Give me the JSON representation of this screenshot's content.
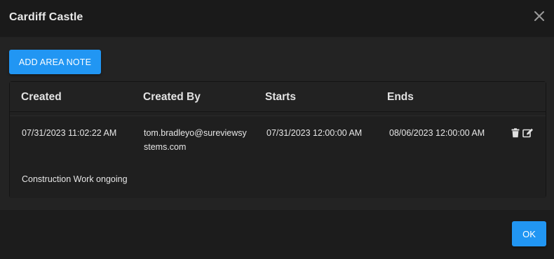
{
  "dialog": {
    "title": "Cardiff Castle",
    "close_icon": "close-icon"
  },
  "toolbar": {
    "add_label": "ADD AREA NOTE"
  },
  "table": {
    "columns": [
      "Created",
      "Created By",
      "Starts",
      "Ends"
    ],
    "rows": [
      {
        "created": "07/31/2023 11:02:22 AM",
        "created_by": "tom.bradleyo@sureviewsystems.com",
        "starts": "07/31/2023 12:00:00 AM",
        "ends": "08/06/2023 12:00:00 AM",
        "note": "Construction Work ongoing",
        "actions": [
          "trash-icon",
          "edit-icon"
        ]
      }
    ]
  },
  "footer": {
    "ok_label": "OK"
  },
  "colors": {
    "accent": "#2196f3",
    "background": "#1c1c1c",
    "text": "#e6e6e6"
  }
}
